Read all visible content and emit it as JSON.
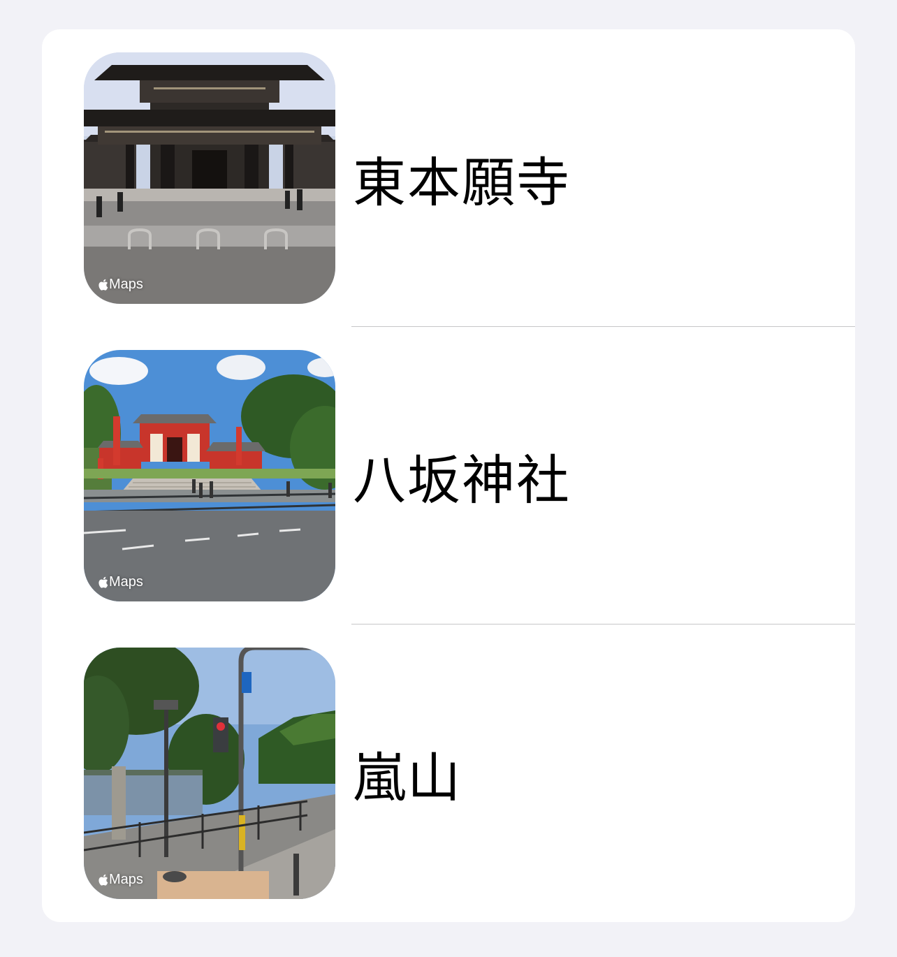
{
  "places": [
    {
      "name": "東本願寺",
      "badge": "Maps",
      "photo_icon": "temple-gate-photo"
    },
    {
      "name": "八坂神社",
      "badge": "Maps",
      "photo_icon": "shrine-photo"
    },
    {
      "name": "嵐山",
      "badge": "Maps",
      "photo_icon": "street-crossing-photo"
    }
  ],
  "colors": {
    "background": "#f2f2f7",
    "card": "#ffffff",
    "separator": "#c6c6c8",
    "text": "#000000"
  }
}
